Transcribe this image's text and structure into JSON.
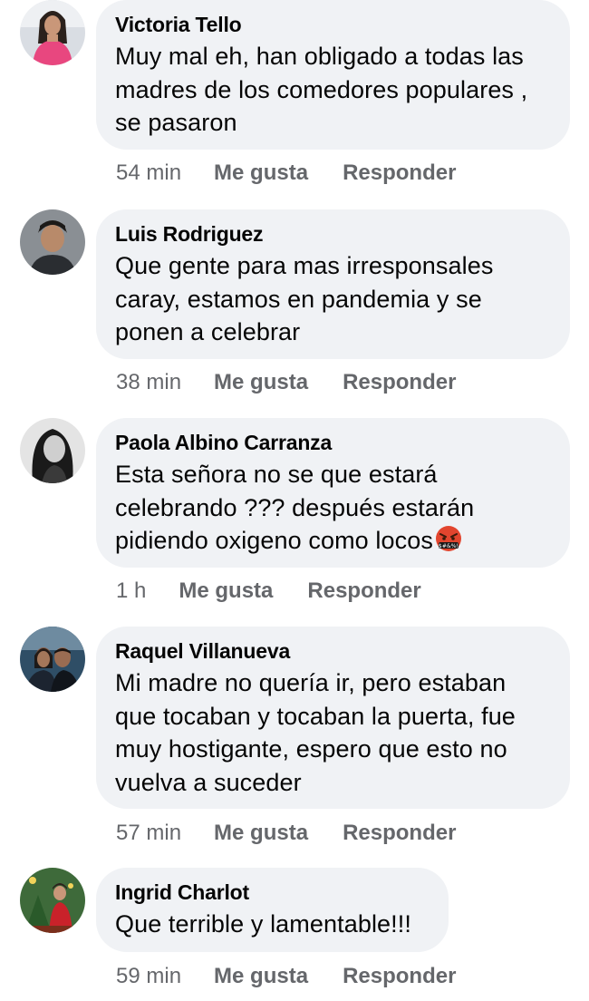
{
  "comments": [
    {
      "author": "Victoria Tello",
      "text": "Muy mal eh, han obligado a todas las madres de los comedores populares , se pasaron",
      "time": "54 min",
      "like": "Me gusta",
      "reply": "Responder",
      "avatar_icon": "avatar-woman-pink-top"
    },
    {
      "author": "Luis Rodriguez",
      "text": "Que gente para mas irresponsales caray, estamos en pandemia y se ponen a celebrar",
      "time": "38 min",
      "like": "Me gusta",
      "reply": "Responder",
      "avatar_icon": "avatar-man"
    },
    {
      "author": "Paola Albino Carranza",
      "text": "Esta señora no se que estará celebrando ??? después estarán pidiendo oxigeno como locos",
      "emoji": "cursing-face-emoji",
      "time": "1 h",
      "like": "Me gusta",
      "reply": "Responder",
      "avatar_icon": "avatar-woman-bw"
    },
    {
      "author": "Raquel Villanueva",
      "text": "Mi madre no quería ir, pero estaban que tocaban y tocaban la puerta, fue muy hostigante, espero que esto no vuelva a suceder",
      "time": "57 min",
      "like": "Me gusta",
      "reply": "Responder",
      "avatar_icon": "avatar-couple"
    },
    {
      "author": "Ingrid Charlot",
      "text": "Que terrible y lamentable!!!",
      "time": "59 min",
      "like": "Me gusta",
      "reply": "Responder",
      "avatar_icon": "avatar-christmas"
    }
  ],
  "colors": {
    "bubble": "#f0f2f5",
    "meta_text": "#65676b",
    "text": "#050505"
  }
}
